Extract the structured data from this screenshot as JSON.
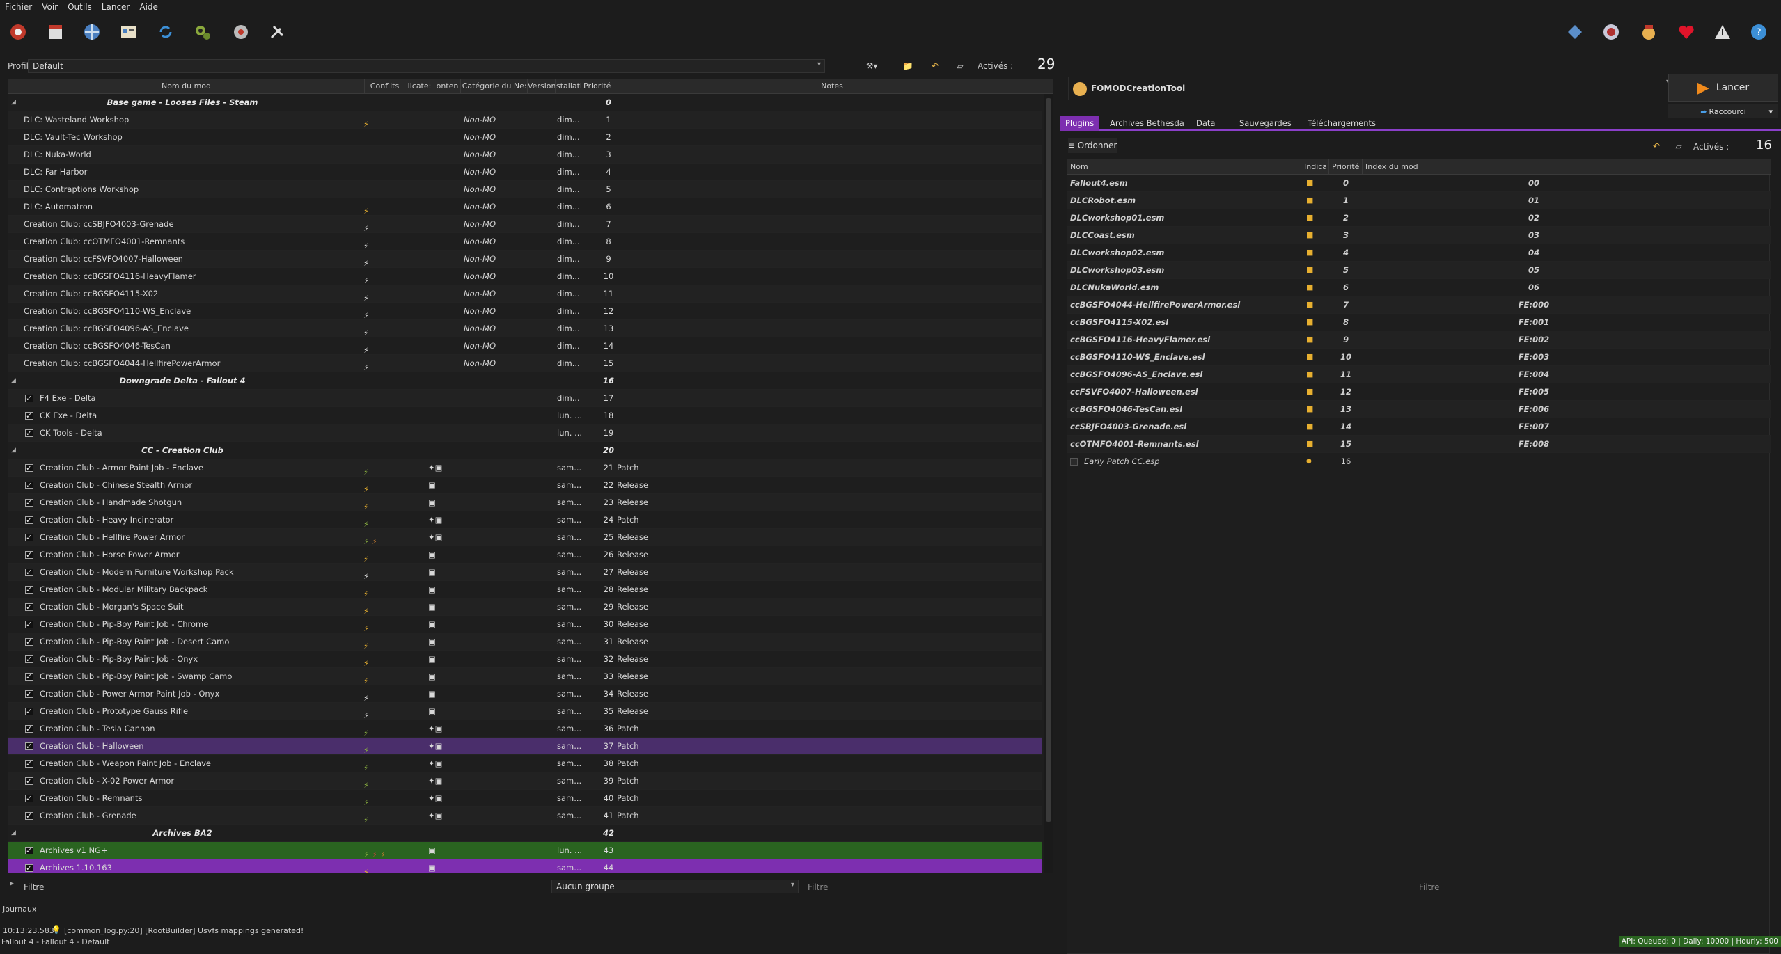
{
  "menu": [
    "Fichier",
    "Voir",
    "Outils",
    "Lancer",
    "Aide"
  ],
  "profile": {
    "label": "Profil",
    "value": "Default",
    "active_label": "Activés :",
    "active_count": "29"
  },
  "columns": {
    "name": "Nom du mod",
    "conflicts": "Conflits",
    "flags": "licate:",
    "content": "onten",
    "category": "Catégorie",
    "nexus": "du Ne:",
    "version": "Version",
    "installed": "stallati",
    "priority": "Priorité",
    "notes": "Notes"
  },
  "mods": [
    {
      "type": "sep",
      "name": "Base game - Looses Files - Steam",
      "prio": "0"
    },
    {
      "type": "mod",
      "name": "DLC: Wasteland Workshop",
      "confl": "y",
      "cat": "Non-MO",
      "inst": "dim...",
      "prio": "1"
    },
    {
      "type": "mod",
      "name": "DLC: Vault-Tec Workshop",
      "confl": "",
      "cat": "Non-MO",
      "inst": "dim...",
      "prio": "2"
    },
    {
      "type": "mod",
      "name": "DLC: Nuka-World",
      "confl": "",
      "cat": "Non-MO",
      "inst": "dim...",
      "prio": "3"
    },
    {
      "type": "mod",
      "name": "DLC: Far Harbor",
      "confl": "",
      "cat": "Non-MO",
      "inst": "dim...",
      "prio": "4"
    },
    {
      "type": "mod",
      "name": "DLC: Contraptions Workshop",
      "confl": "",
      "cat": "Non-MO",
      "inst": "dim...",
      "prio": "5"
    },
    {
      "type": "mod",
      "name": "DLC: Automatron",
      "confl": "y",
      "cat": "Non-MO",
      "inst": "dim...",
      "prio": "6"
    },
    {
      "type": "mod",
      "name": "Creation Club: ccSBJFO4003-Grenade",
      "confl": "w",
      "cat": "Non-MO",
      "inst": "dim...",
      "prio": "7"
    },
    {
      "type": "mod",
      "name": "Creation Club: ccOTMFO4001-Remnants",
      "confl": "w",
      "cat": "Non-MO",
      "inst": "dim...",
      "prio": "8"
    },
    {
      "type": "mod",
      "name": "Creation Club: ccFSVFO4007-Halloween",
      "confl": "w",
      "cat": "Non-MO",
      "inst": "dim...",
      "prio": "9"
    },
    {
      "type": "mod",
      "name": "Creation Club: ccBGSFO4116-HeavyFlamer",
      "confl": "w",
      "cat": "Non-MO",
      "inst": "dim...",
      "prio": "10"
    },
    {
      "type": "mod",
      "name": "Creation Club: ccBGSFO4115-X02",
      "confl": "w",
      "cat": "Non-MO",
      "inst": "dim...",
      "prio": "11"
    },
    {
      "type": "mod",
      "name": "Creation Club: ccBGSFO4110-WS_Enclave",
      "confl": "w",
      "cat": "Non-MO",
      "inst": "dim...",
      "prio": "12"
    },
    {
      "type": "mod",
      "name": "Creation Club: ccBGSFO4096-AS_Enclave",
      "confl": "w",
      "cat": "Non-MO",
      "inst": "dim...",
      "prio": "13"
    },
    {
      "type": "mod",
      "name": "Creation Club: ccBGSFO4046-TesCan",
      "confl": "w",
      "cat": "Non-MO",
      "inst": "dim...",
      "prio": "14"
    },
    {
      "type": "mod",
      "name": "Creation Club: ccBGSFO4044-HellfirePowerArmor",
      "confl": "w",
      "cat": "Non-MO",
      "inst": "dim...",
      "prio": "15"
    },
    {
      "type": "sep",
      "name": "Downgrade Delta - Fallout 4",
      "prio": "16"
    },
    {
      "type": "chk",
      "name": "F4 Exe - Delta",
      "inst": "dim...",
      "prio": "17"
    },
    {
      "type": "chk",
      "name": "CK Exe - Delta",
      "inst": "lun. ...",
      "prio": "18"
    },
    {
      "type": "chk",
      "name": "CK Tools - Delta",
      "inst": "lun. ...",
      "prio": "19"
    },
    {
      "type": "sep",
      "name": "CC - Creation Club",
      "prio": "20"
    },
    {
      "type": "chk",
      "name": "Creation Club - Armor Paint Job - Enclave",
      "confl": "g",
      "flags": "pd",
      "inst": "sam...",
      "prio": "21",
      "notes": "Patch"
    },
    {
      "type": "chk",
      "name": "Creation Club - Chinese Stealth Armor",
      "confl": "y",
      "flags": "d",
      "inst": "sam...",
      "prio": "22",
      "notes": "Release"
    },
    {
      "type": "chk",
      "name": "Creation Club - Handmade Shotgun",
      "confl": "y",
      "flags": "d",
      "inst": "sam...",
      "prio": "23",
      "notes": "Release"
    },
    {
      "type": "chk",
      "name": "Creation Club - Heavy Incinerator",
      "confl": "g",
      "flags": "pd",
      "inst": "sam...",
      "prio": "24",
      "notes": "Patch"
    },
    {
      "type": "chk",
      "name": "Creation Club - Hellfire Power Armor",
      "confl": "gx",
      "flags": "pd",
      "inst": "sam...",
      "prio": "25",
      "notes": "Release"
    },
    {
      "type": "chk",
      "name": "Creation Club - Horse Power Armor",
      "confl": "y",
      "flags": "d",
      "inst": "sam...",
      "prio": "26",
      "notes": "Release"
    },
    {
      "type": "chk",
      "name": "Creation Club - Modern Furniture Workshop Pack",
      "confl": "w",
      "flags": "d",
      "inst": "sam...",
      "prio": "27",
      "notes": "Release"
    },
    {
      "type": "chk",
      "name": "Creation Club - Modular Military Backpack",
      "confl": "y",
      "flags": "d",
      "inst": "sam...",
      "prio": "28",
      "notes": "Release"
    },
    {
      "type": "chk",
      "name": "Creation Club - Morgan's Space Suit",
      "confl": "y",
      "flags": "d",
      "inst": "sam...",
      "prio": "29",
      "notes": "Release"
    },
    {
      "type": "chk",
      "name": "Creation Club - Pip-Boy Paint Job - Chrome",
      "confl": "y",
      "flags": "d",
      "inst": "sam...",
      "prio": "30",
      "notes": "Release"
    },
    {
      "type": "chk",
      "name": "Creation Club - Pip-Boy Paint Job - Desert Camo",
      "confl": "y",
      "flags": "d",
      "inst": "sam...",
      "prio": "31",
      "notes": "Release"
    },
    {
      "type": "chk",
      "name": "Creation Club - Pip-Boy Paint Job - Onyx",
      "confl": "y",
      "flags": "d",
      "inst": "sam...",
      "prio": "32",
      "notes": "Release"
    },
    {
      "type": "chk",
      "name": "Creation Club - Pip-Boy Paint Job - Swamp Camo",
      "confl": "y",
      "flags": "d",
      "inst": "sam...",
      "prio": "33",
      "notes": "Release"
    },
    {
      "type": "chk",
      "name": "Creation Club - Power Armor Paint Job - Onyx",
      "confl": "w",
      "flags": "d",
      "inst": "sam...",
      "prio": "34",
      "notes": "Release"
    },
    {
      "type": "chk",
      "name": "Creation Club - Prototype Gauss Rifle",
      "confl": "w",
      "flags": "d",
      "inst": "sam...",
      "prio": "35",
      "notes": "Release"
    },
    {
      "type": "chk",
      "name": "Creation Club - Tesla Cannon",
      "confl": "g",
      "flags": "pd",
      "inst": "sam...",
      "prio": "36",
      "notes": "Patch"
    },
    {
      "type": "chk",
      "name": "Creation Club - Halloween",
      "confl": "g",
      "flags": "pd",
      "inst": "sam...",
      "prio": "37",
      "notes": "Patch",
      "state": "sel"
    },
    {
      "type": "chk",
      "name": "Creation Club - Weapon Paint Job - Enclave",
      "confl": "g",
      "flags": "pd",
      "inst": "sam...",
      "prio": "38",
      "notes": "Patch"
    },
    {
      "type": "chk",
      "name": "Creation Club - X-02 Power Armor",
      "confl": "g",
      "flags": "pd",
      "inst": "sam...",
      "prio": "39",
      "notes": "Patch"
    },
    {
      "type": "chk",
      "name": "Creation Club - Remnants",
      "confl": "g",
      "flags": "pd",
      "inst": "sam...",
      "prio": "40",
      "notes": "Patch"
    },
    {
      "type": "chk",
      "name": "Creation Club - Grenade",
      "confl": "g",
      "flags": "pd",
      "inst": "sam...",
      "prio": "41",
      "notes": "Patch"
    },
    {
      "type": "sep",
      "name": "Archives BA2",
      "prio": "42"
    },
    {
      "type": "chk",
      "name": "Archives v1 NG+",
      "confl": "grx",
      "flags": "d",
      "inst": "lun. ...",
      "prio": "43",
      "state": "green"
    },
    {
      "type": "chk",
      "name": "Archives 1.10.163",
      "confl": "y",
      "flags": "d",
      "inst": "sam...",
      "prio": "44",
      "state": "purple"
    }
  ],
  "filter": {
    "placeholder": "Filtre",
    "group": "Aucun groupe",
    "placeholder2": "Filtre"
  },
  "right": {
    "exe": "FOMODCreationTool",
    "launch": "Lancer",
    "shortcut": "Raccourci",
    "tabs": [
      "Plugins",
      "Archives Bethesda",
      "Data",
      "Sauvegardes",
      "Téléchargements"
    ],
    "sort": "Ordonner",
    "active_label": "Activés :",
    "active_count": "16",
    "columns": {
      "name": "Nom",
      "flags": "Indica",
      "priority": "Priorité",
      "index": "Index du mod"
    },
    "plugins": [
      {
        "name": "Fallout4.esm",
        "prio": "0",
        "idx": "00"
      },
      {
        "name": "DLCRobot.esm",
        "prio": "1",
        "idx": "01"
      },
      {
        "name": "DLCworkshop01.esm",
        "prio": "2",
        "idx": "02"
      },
      {
        "name": "DLCCoast.esm",
        "prio": "3",
        "idx": "03"
      },
      {
        "name": "DLCworkshop02.esm",
        "prio": "4",
        "idx": "04"
      },
      {
        "name": "DLCworkshop03.esm",
        "prio": "5",
        "idx": "05"
      },
      {
        "name": "DLCNukaWorld.esm",
        "prio": "6",
        "idx": "06"
      },
      {
        "name": "ccBGSFO4044-HellfirePowerArmor.esl",
        "prio": "7",
        "idx": "FE:000"
      },
      {
        "name": "ccBGSFO4115-X02.esl",
        "prio": "8",
        "idx": "FE:001"
      },
      {
        "name": "ccBGSFO4116-HeavyFlamer.esl",
        "prio": "9",
        "idx": "FE:002"
      },
      {
        "name": "ccBGSFO4110-WS_Enclave.esl",
        "prio": "10",
        "idx": "FE:003"
      },
      {
        "name": "ccBGSFO4096-AS_Enclave.esl",
        "prio": "11",
        "idx": "FE:004"
      },
      {
        "name": "ccFSVFO4007-Halloween.esl",
        "prio": "12",
        "idx": "FE:005"
      },
      {
        "name": "ccBGSFO4046-TesCan.esl",
        "prio": "13",
        "idx": "FE:006"
      },
      {
        "name": "ccSBJFO4003-Grenade.esl",
        "prio": "14",
        "idx": "FE:007"
      },
      {
        "name": "ccOTMFO4001-Remnants.esl",
        "prio": "15",
        "idx": "FE:008"
      },
      {
        "name": "Early Patch CC.esp",
        "prio": "16",
        "idx": "",
        "unchecked": true
      }
    ],
    "filter": "Filtre"
  },
  "log": {
    "title": "Journaux",
    "time": "10:13:23.583",
    "message": "[common_log.py:20] [RootBuilder] Usvfs mappings generated!"
  },
  "status": {
    "left": "Fallout 4 - Fallout 4 - Default",
    "right": "API: Queued: 0 | Daily: 10000 | Hourly: 500"
  },
  "colors": {
    "accent": "#7d2fb0",
    "selected": "#4a2e6b",
    "green": "#2a6420"
  }
}
